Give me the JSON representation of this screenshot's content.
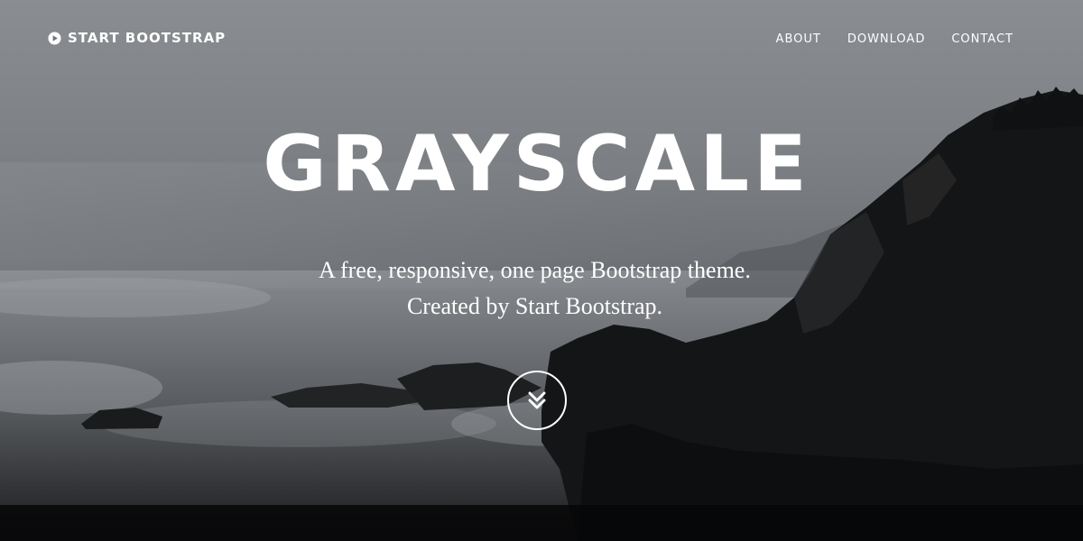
{
  "navbar": {
    "brand_icon": "play-circle-icon",
    "brand_label": "START BOOTSTRAP",
    "links": [
      {
        "label": "ABOUT"
      },
      {
        "label": "DOWNLOAD"
      },
      {
        "label": "CONTACT"
      }
    ]
  },
  "hero": {
    "title": "GRAYSCALE",
    "subtitle_line1": "A free, responsive, one page Bootstrap theme.",
    "subtitle_line2": "Created by Start Bootstrap.",
    "scroll_icon": "double-chevron-down-icon"
  },
  "colors": {
    "text": "#ffffff",
    "sky": "#8a8d91",
    "rock": "#141516"
  }
}
